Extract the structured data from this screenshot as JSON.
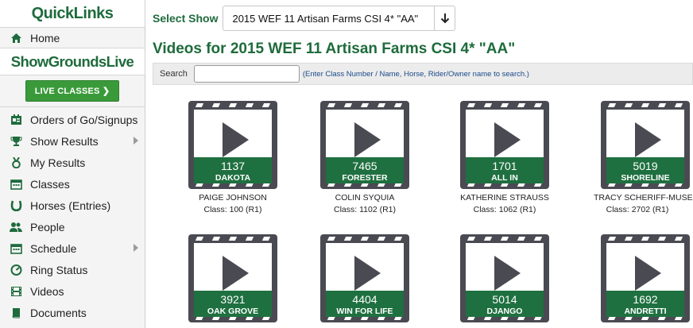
{
  "sidebar": {
    "quicklinks_title": "QuickLinks",
    "home_label": "Home",
    "sgl_title": "ShowGroundsLive",
    "live_button": "LIVE CLASSES",
    "items": [
      {
        "label": "Orders of Go/Signups",
        "icon": "clipboard-icon"
      },
      {
        "label": "Show Results",
        "icon": "trophy-icon",
        "submenu": true
      },
      {
        "label": "My Results",
        "icon": "medal-icon"
      },
      {
        "label": "Classes",
        "icon": "calendar-icon"
      },
      {
        "label": "Horses (Entries)",
        "icon": "horseshoe-icon"
      },
      {
        "label": "People",
        "icon": "users-icon"
      },
      {
        "label": "Schedule",
        "icon": "calendar-icon",
        "submenu": true
      },
      {
        "label": "Ring Status",
        "icon": "dashboard-icon"
      },
      {
        "label": "Videos",
        "icon": "film-icon"
      },
      {
        "label": "Documents",
        "icon": "book-icon"
      }
    ]
  },
  "header": {
    "select_label": "Select Show",
    "select_value": "2015 WEF 11 Artisan Farms CSI 4* \"AA\"",
    "title": "Videos for 2015 WEF 11 Artisan Farms CSI 4* \"AA\""
  },
  "search": {
    "label": "Search",
    "value": "",
    "hint": "(Enter Class Number / Name, Horse, Rider/Owner name to search.)"
  },
  "videos": [
    {
      "number": "1137",
      "horse": "DAKOTA",
      "rider": "PAIGE JOHNSON",
      "class": "Class: 100 (R1)"
    },
    {
      "number": "7465",
      "horse": "FORESTER",
      "rider": "COLIN SYQUIA",
      "class": "Class: 1102 (R1)"
    },
    {
      "number": "1701",
      "horse": "ALL IN",
      "rider": "KATHERINE STRAUSS",
      "class": "Class: 1062 (R1)"
    },
    {
      "number": "5019",
      "horse": "SHORELINE",
      "rider": "TRACY SCHERIFF-MUSER",
      "class": "Class: 2702 (R1)"
    },
    {
      "number": "3921",
      "horse": "OAK GROVE",
      "rider": "",
      "class": ""
    },
    {
      "number": "4404",
      "horse": "WIN FOR LIFE",
      "rider": "",
      "class": ""
    },
    {
      "number": "5014",
      "horse": "DJANGO",
      "rider": "",
      "class": ""
    },
    {
      "number": "1692",
      "horse": "ANDRETTI",
      "rider": "",
      "class": ""
    }
  ],
  "colors": {
    "brand_green": "#1e6b3c",
    "live_green": "#3a9a3a",
    "film_gray": "#4a4a52"
  }
}
